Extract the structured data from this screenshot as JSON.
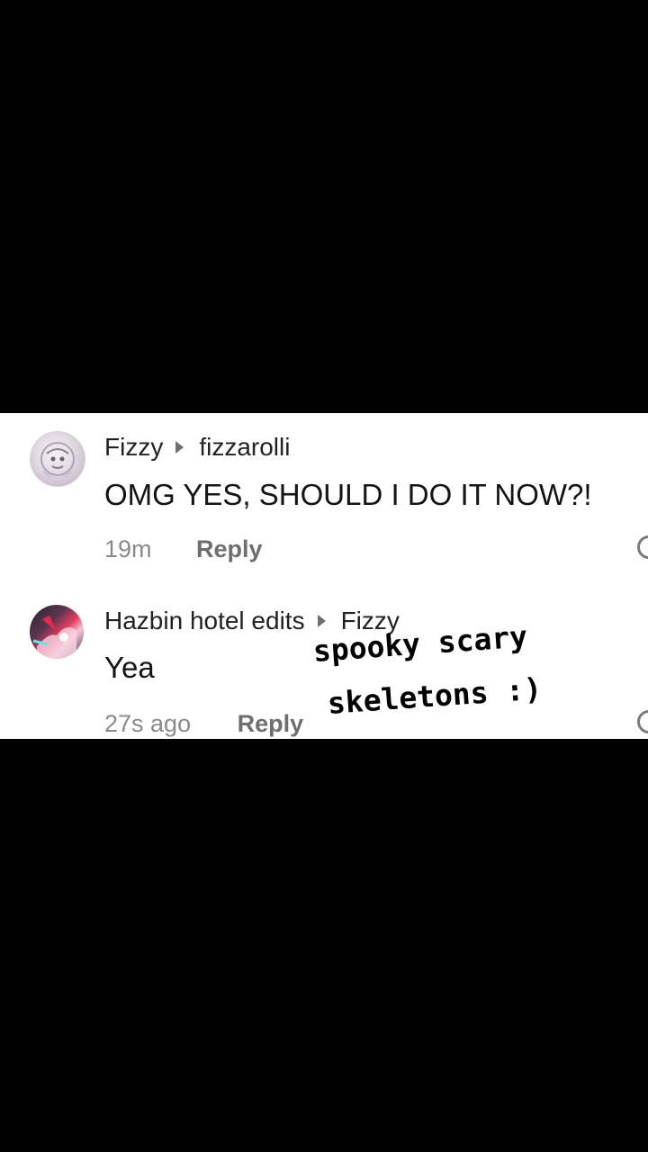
{
  "comments": [
    {
      "author": "Fizzy",
      "reply_to": "fizzarolli",
      "text": "OMG YES, SHOULD I DO IT NOW?!",
      "time": "19m",
      "reply_label": "Reply",
      "avatar_icon": "avatar-fizzy-icon"
    },
    {
      "author": "Hazbin hotel edits",
      "reply_to": "Fizzy",
      "text": "Yea",
      "time": "27s ago",
      "reply_label": "Reply",
      "avatar_icon": "avatar-hazbin-icon"
    }
  ],
  "overlay": {
    "line1": "spooky scary",
    "line2": "skeletons :)"
  },
  "colors": {
    "background": "#000000",
    "panel": "#ffffff",
    "name": "#222222",
    "meta": "#8a8a8a",
    "reply": "#6f6f6f"
  }
}
